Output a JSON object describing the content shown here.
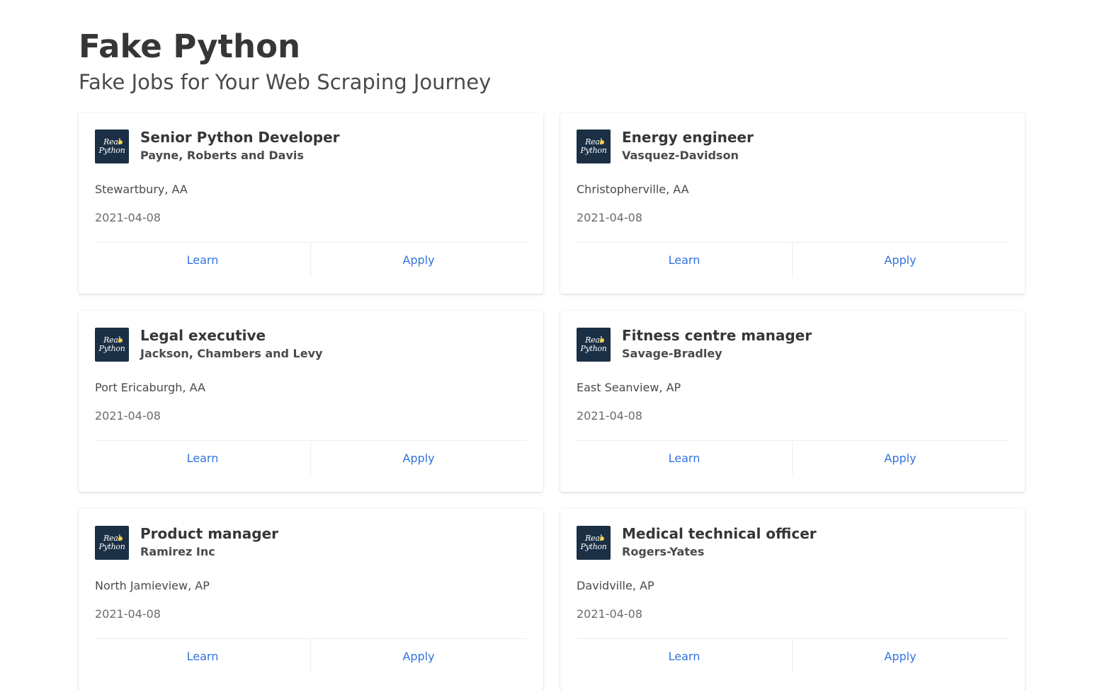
{
  "header": {
    "title": "Fake Python",
    "subtitle": "Fake Jobs for Your Web Scraping Journey"
  },
  "logo": {
    "line1": "Real",
    "line2": "Python",
    "bg_color": "#1b2f45",
    "dot_color": "#f3d142"
  },
  "colors": {
    "link": "#3273dc",
    "title": "#363636"
  },
  "jobs": [
    {
      "title": "Senior Python Developer",
      "company": "Payne, Roberts and Davis",
      "location": "Stewartbury, AA",
      "date": "2021-04-08",
      "learn_label": "Learn",
      "apply_label": "Apply"
    },
    {
      "title": "Energy engineer",
      "company": "Vasquez-Davidson",
      "location": "Christopherville, AA",
      "date": "2021-04-08",
      "learn_label": "Learn",
      "apply_label": "Apply"
    },
    {
      "title": "Legal executive",
      "company": "Jackson, Chambers and Levy",
      "location": "Port Ericaburgh, AA",
      "date": "2021-04-08",
      "learn_label": "Learn",
      "apply_label": "Apply"
    },
    {
      "title": "Fitness centre manager",
      "company": "Savage-Bradley",
      "location": "East Seanview, AP",
      "date": "2021-04-08",
      "learn_label": "Learn",
      "apply_label": "Apply"
    },
    {
      "title": "Product manager",
      "company": "Ramirez Inc",
      "location": "North Jamieview, AP",
      "date": "2021-04-08",
      "learn_label": "Learn",
      "apply_label": "Apply"
    },
    {
      "title": "Medical technical officer",
      "company": "Rogers-Yates",
      "location": "Davidville, AP",
      "date": "2021-04-08",
      "learn_label": "Learn",
      "apply_label": "Apply"
    }
  ]
}
